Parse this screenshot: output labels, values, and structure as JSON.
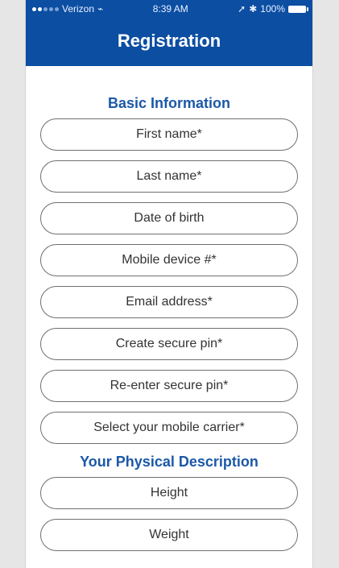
{
  "status_bar": {
    "carrier": "Verizon",
    "time": "8:39 AM",
    "battery": "100%"
  },
  "header": {
    "title": "Registration"
  },
  "sections": {
    "basic": {
      "title": "Basic Information",
      "fields": [
        "First name*",
        "Last name*",
        "Date of birth",
        "Mobile device #*",
        "Email address*",
        "Create secure pin*",
        "Re-enter secure pin*",
        "Select your mobile carrier*"
      ]
    },
    "physical": {
      "title": "Your Physical Description",
      "fields": [
        "Height",
        "Weight"
      ]
    }
  },
  "colors": {
    "brand": "#0b4ea2",
    "section_title": "#1b58a8"
  }
}
